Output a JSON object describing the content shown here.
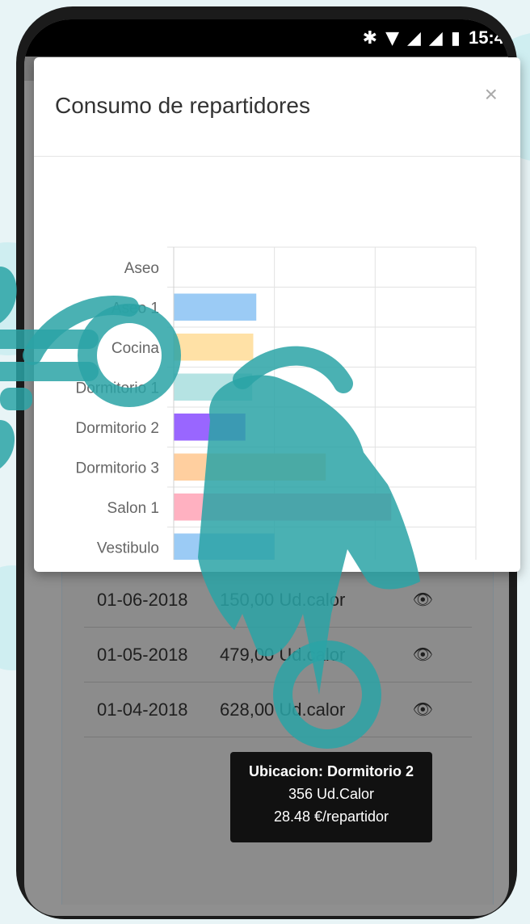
{
  "status_bar": {
    "time": "15:4",
    "bluetooth_icon": "bluetooth-icon",
    "wifi_icon": "wifi-icon",
    "signal_icon": "signal-icon",
    "battery_icon": "battery-icon"
  },
  "modal": {
    "title": "Consumo de repartidores",
    "close_label": "×"
  },
  "chart_data": {
    "type": "bar",
    "orientation": "horizontal",
    "categories": [
      "Aseo",
      "Aseo 1",
      "Cocina",
      "Dormitorio 1",
      "Dormitorio 2",
      "Dormitorio 3",
      "Salon 1",
      "Vestibulo"
    ],
    "values": [
      0,
      410,
      395,
      390,
      356,
      755,
      1080,
      500
    ],
    "xlim": [
      0,
      1500
    ],
    "xticks": [
      "0",
      "500",
      "1000",
      "1500"
    ],
    "grid": true,
    "colors": [
      "#9bcbf5",
      "#9bcbf5",
      "#ffe1a6",
      "#b5e3e3",
      "#9966ff",
      "#ffcf9f",
      "#ffb1c1",
      "#9bcbf5"
    ]
  },
  "rows": [
    {
      "date": "01-06-2018",
      "value": "150,00 Ud.calor"
    },
    {
      "date": "01-05-2018",
      "value": "479,00 Ud.calor"
    },
    {
      "date": "01-04-2018",
      "value": "628,00 Ud.calor"
    }
  ],
  "tooltip": {
    "title": "Ubicacion: Dormitorio 2",
    "line1": "356 Ud.Calor",
    "line2": "28.48 €/repartidor"
  },
  "colors": {
    "overlay_teal": "#2aa3a6"
  }
}
